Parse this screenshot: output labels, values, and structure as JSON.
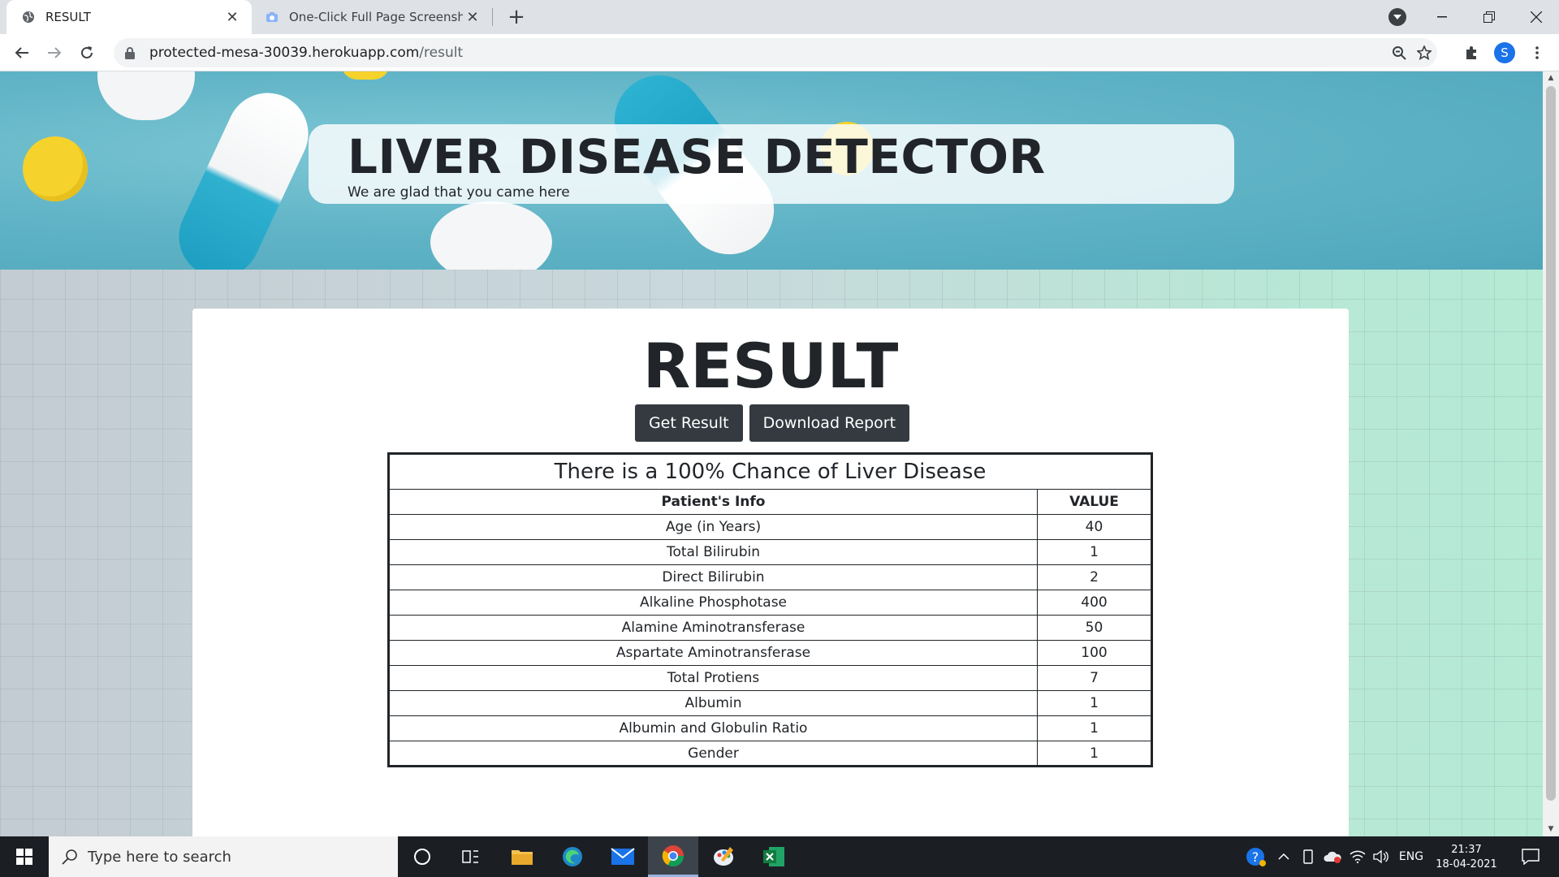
{
  "browser": {
    "tabs": [
      {
        "title": "RESULT",
        "active": true
      },
      {
        "title": "One-Click Full Page Screenshot",
        "active": false
      }
    ],
    "url_host": "protected-mesa-30039.herokuapp.com",
    "url_path": "/result",
    "profile_initial": "S"
  },
  "hero": {
    "title": "LIVER DISEASE DETECTOR",
    "subtitle": "We are glad that you came here"
  },
  "result": {
    "heading": "RESULT",
    "buttons": {
      "get_result": "Get Result",
      "download_report": "Download Report"
    },
    "table": {
      "caption": "There is a 100% Chance of Liver Disease",
      "headers": [
        "Patient's Info",
        "VALUE"
      ],
      "rows": [
        {
          "label": "Age (in Years)",
          "value": "40"
        },
        {
          "label": "Total Bilirubin",
          "value": "1"
        },
        {
          "label": "Direct Bilirubin",
          "value": "2"
        },
        {
          "label": "Alkaline Phosphotase",
          "value": "400"
        },
        {
          "label": "Alamine Aminotransferase",
          "value": "50"
        },
        {
          "label": "Aspartate Aminotransferase",
          "value": "100"
        },
        {
          "label": "Total Protiens",
          "value": "7"
        },
        {
          "label": "Albumin",
          "value": "1"
        },
        {
          "label": "Albumin and Globulin Ratio",
          "value": "1"
        },
        {
          "label": "Gender",
          "value": "1"
        }
      ]
    }
  },
  "taskbar": {
    "search_placeholder": "Type here to search",
    "language": "ENG",
    "time": "21:37",
    "date": "18-04-2021"
  },
  "colors": {
    "button_bg": "#343a40",
    "hero_bg": "#62b5c7",
    "accent_blue": "#1a73e8"
  }
}
